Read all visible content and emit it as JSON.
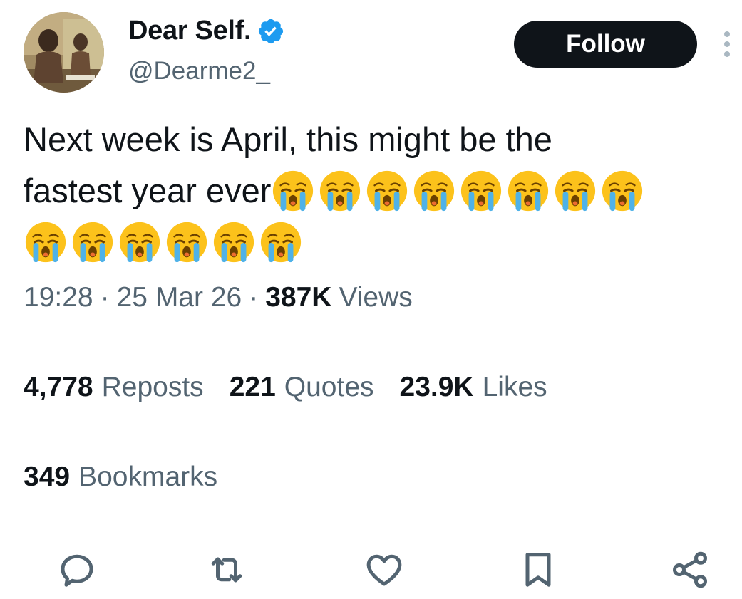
{
  "author": {
    "display_name": "Dear Self.",
    "handle": "@Dearme2_",
    "verified": true
  },
  "follow_label": "Follow",
  "tweet": {
    "line1": "Next week is April, this might be the",
    "line2_text": "fastest year ever",
    "emoji": "loudly-crying-face",
    "emoji_count_line2": 8,
    "emoji_count_line3": 6
  },
  "meta": {
    "time": "19:28",
    "date": "25 Mar 26",
    "views_count": "387K",
    "views_label": "Views",
    "separator": "·"
  },
  "stats": [
    {
      "count": "4,778",
      "label": "Reposts"
    },
    {
      "count": "221",
      "label": "Quotes"
    },
    {
      "count": "23.9K",
      "label": "Likes"
    }
  ],
  "bookmarks": {
    "count": "349",
    "label": "Bookmarks"
  },
  "actions": [
    "reply-icon",
    "repost-icon",
    "like-icon",
    "bookmark-icon",
    "share-icon"
  ],
  "colors": {
    "text_primary": "#0f1419",
    "text_secondary": "#536471",
    "verified_blue": "#1d9bf0",
    "button_bg": "#0f1419",
    "divider": "#dfe3e6"
  }
}
